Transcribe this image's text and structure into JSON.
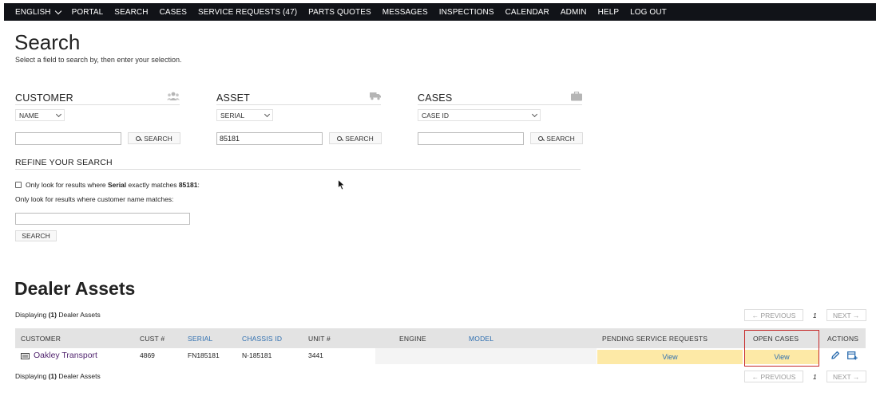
{
  "nav": {
    "items": [
      "ENGLISH",
      "PORTAL",
      "SEARCH",
      "CASES",
      "SERVICE REQUESTS (47)",
      "PARTS QUOTES",
      "MESSAGES",
      "INSPECTIONS",
      "CALENDAR",
      "ADMIN",
      "HELP",
      "LOG OUT"
    ]
  },
  "page": {
    "title": "Search",
    "subtitle": "Select a field to search by, then enter your selection."
  },
  "panels": {
    "customer": {
      "heading": "CUSTOMER",
      "field": "NAME",
      "value": "",
      "button": "SEARCH",
      "icon": "users-icon"
    },
    "asset": {
      "heading": "ASSET",
      "field": "SERIAL",
      "value": "85181",
      "button": "SEARCH",
      "icon": "truck-icon"
    },
    "cases": {
      "heading": "CASES",
      "field": "CASE ID",
      "value": "",
      "button": "SEARCH",
      "icon": "briefcase-icon"
    }
  },
  "refine": {
    "heading": "REFINE YOUR SEARCH",
    "checkbox_pre": "Only look for results where ",
    "checkbox_field": "Serial",
    "checkbox_mid": " exactly matches ",
    "checkbox_value": "85181",
    "checkbox_post": ":",
    "customer_label": "Only look for results where customer name matches:",
    "button": "SEARCH"
  },
  "dealer_assets": {
    "title": "Dealer Assets",
    "displaying_pre": "Displaying ",
    "displaying_count": "(1)",
    "displaying_post": " Dealer Assets",
    "pager": {
      "prev": "← PREVIOUS",
      "page": "1",
      "next": "NEXT →"
    },
    "columns": {
      "customer": "CUSTOMER",
      "cust_no": "CUST #",
      "serial": "SERIAL",
      "chassis": "CHASSIS ID",
      "unit": "UNIT #",
      "engine": "ENGINE",
      "model": "MODEL",
      "pending": "PENDING SERVICE REQUESTS",
      "open_cases": "OPEN CASES",
      "actions": "ACTIONS"
    },
    "rows": [
      {
        "customer": "Oakley Transport",
        "cust_no": "4869",
        "serial": "FN185181",
        "chassis": "N-185181",
        "unit": "3441",
        "engine": "",
        "model": "",
        "pending": "View",
        "open_cases": "View"
      }
    ]
  },
  "colors": {
    "nav_bg": "#111318",
    "link_blue": "#2f6fb0",
    "customer_link": "#4d1f6b",
    "view_bg": "#fde9a6",
    "highlight": "#c62828"
  }
}
